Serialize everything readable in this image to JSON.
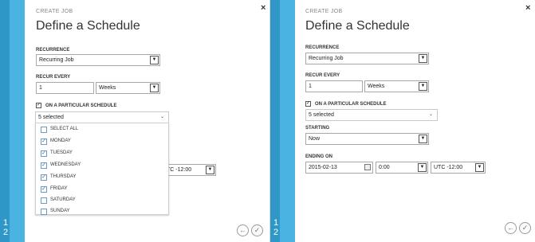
{
  "steps": [
    "1",
    "2"
  ],
  "close_glyph": "×",
  "crumb": "CREATE JOB",
  "title": "Define a Schedule",
  "recurrence_label": "RECURRENCE",
  "recurrence_value": "Recurring Job",
  "recur_every_label": "RECUR EVERY",
  "recur_every_value": "1",
  "recur_unit_value": "Weeks",
  "particular_label": "ON A PARTICULAR SCHEDULE",
  "particular_value": "5 selected",
  "partial_tz": "TC -12:00",
  "days": [
    {
      "label": "SELECT ALL",
      "checked": false
    },
    {
      "label": "MONDAY",
      "checked": true
    },
    {
      "label": "TUESDAY",
      "checked": true
    },
    {
      "label": "WEDNESDAY",
      "checked": true
    },
    {
      "label": "THURSDAY",
      "checked": true
    },
    {
      "label": "FRIDAY",
      "checked": true
    },
    {
      "label": "SATURDAY",
      "checked": false
    },
    {
      "label": "SUNDAY",
      "checked": false
    }
  ],
  "starting_label": "STARTING",
  "starting_value": "Now",
  "ending_label": "ENDING ON",
  "ending_date": "2015-02-13",
  "ending_time": "0:00",
  "ending_tz": "UTC -12:00",
  "check_glyph": "✓",
  "back_glyph": "←",
  "ok_glyph": "✓",
  "colors": {
    "stepbar": "#4ab3e2",
    "stepbar_dark": "#2f96c8",
    "checkbox_check": "#2a6aa8"
  }
}
